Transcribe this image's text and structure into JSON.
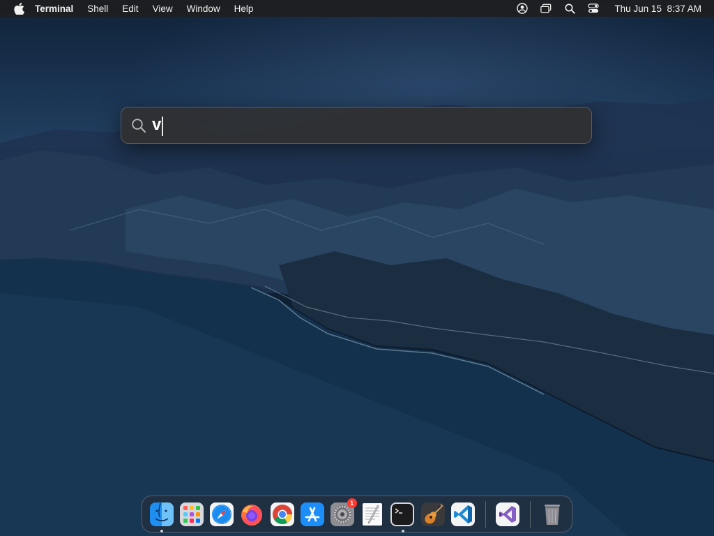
{
  "menubar": {
    "app_name": "Terminal",
    "menus": [
      "Shell",
      "Edit",
      "View",
      "Window",
      "Help"
    ],
    "clock": "Thu Jun 15  8:37 AM",
    "status_icons": [
      "user-account-icon",
      "screen-mirroring-icon",
      "spotlight-search-icon",
      "control-center-icon"
    ]
  },
  "spotlight": {
    "query": "v"
  },
  "dock": {
    "apps": [
      {
        "name": "Finder",
        "icon": "finder-icon",
        "running": true
      },
      {
        "name": "Launchpad",
        "icon": "launchpad-icon",
        "running": false
      },
      {
        "name": "Safari",
        "icon": "safari-icon",
        "running": false
      },
      {
        "name": "Firefox",
        "icon": "firefox-icon",
        "running": false
      },
      {
        "name": "Google Chrome",
        "icon": "chrome-icon",
        "running": false
      },
      {
        "name": "App Store",
        "icon": "app-store-icon",
        "running": false
      },
      {
        "name": "System Preferences",
        "icon": "system-preferences-icon",
        "running": false,
        "badge": "1"
      },
      {
        "name": "TextEdit",
        "icon": "textedit-icon",
        "running": false
      },
      {
        "name": "Terminal",
        "icon": "terminal-icon",
        "running": true
      },
      {
        "name": "Instruments",
        "icon": "guitar-app-icon",
        "running": false
      },
      {
        "name": "Visual Studio Code",
        "icon": "vscode-icon",
        "running": false
      },
      {
        "name": "Visual Studio",
        "icon": "visual-studio-icon",
        "running": false
      },
      {
        "name": "Trash",
        "icon": "trash-icon",
        "running": false
      }
    ]
  },
  "colors": {
    "menubar_bg": "#1e1e20",
    "spotlight_bg": "#303032",
    "badge_red": "#ff3b30"
  }
}
